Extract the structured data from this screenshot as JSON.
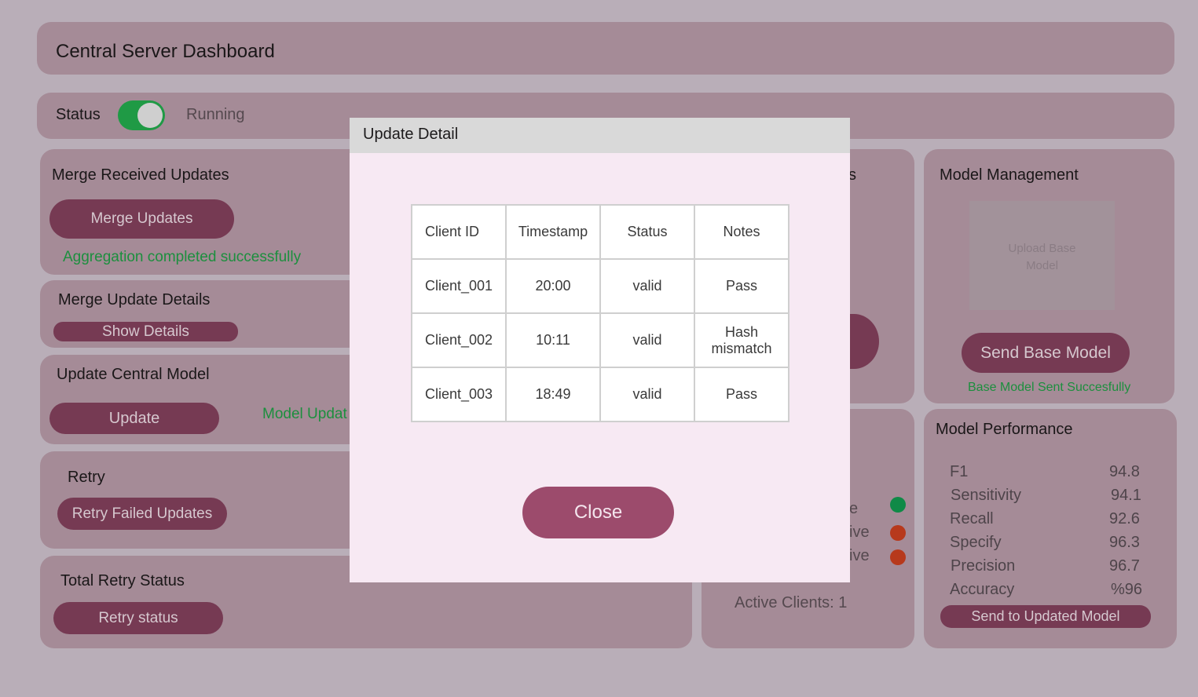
{
  "header": {
    "title": "Central Server Dashboard"
  },
  "status": {
    "label": "Status",
    "toggle_on": true,
    "state": "Running"
  },
  "merge": {
    "title": "Merge Received Updates",
    "button": "Merge Updates",
    "message": "Aggregation completed successfully"
  },
  "merge_details": {
    "title": "Merge Update Details",
    "button": "Show Details"
  },
  "update_central": {
    "title": "Update Central Model",
    "button": "Update",
    "message": "Model Updat"
  },
  "retry": {
    "title": "Retry",
    "button": "Retry Failed Updates"
  },
  "total_retry": {
    "title": "Total Retry Status",
    "button": "Retry status"
  },
  "clients": {
    "title_fragment": "s",
    "rows": [
      {
        "label": "e",
        "status": "active",
        "color": "#0f8a47"
      },
      {
        "label": "ive",
        "status": "inactive",
        "color": "#b7391c"
      },
      {
        "label": "ive",
        "status": "inactive",
        "color": "#b7391c"
      }
    ],
    "active_count": "Active Clients: 1"
  },
  "model_management": {
    "title": "Model Management",
    "upload": "Upload Base Model",
    "button": "Send Base Model",
    "message": "Base Model Sent Succesfully"
  },
  "performance": {
    "title": "Model Performance",
    "metrics": [
      {
        "name": "F1",
        "value": "94.8"
      },
      {
        "name": "Sensitivity",
        "value": "94.1"
      },
      {
        "name": "Recall",
        "value": "92.6"
      },
      {
        "name": "Specify",
        "value": "96.3"
      },
      {
        "name": "Precision",
        "value": "96.7"
      },
      {
        "name": "Accuracy",
        "value": "%96"
      }
    ],
    "button": "Send to Updated Model"
  },
  "modal": {
    "title": "Update Detail",
    "headers": [
      "Client ID",
      "Timestamp",
      "Status",
      "Notes"
    ],
    "rows": [
      [
        "Client_001",
        "20:00",
        "valid",
        "Pass"
      ],
      [
        "Client_002",
        "10:11",
        "valid",
        "Hash mismatch"
      ],
      [
        "Client_003",
        "18:49",
        "valid",
        "Pass"
      ]
    ],
    "close": "Close"
  }
}
